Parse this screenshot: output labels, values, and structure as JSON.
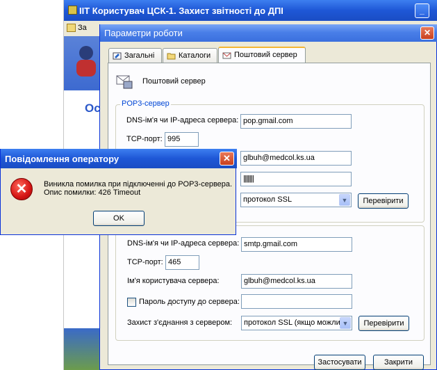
{
  "background_window": {
    "title": "IIT Користувач ЦСК-1. Захист звітності до ДПІ",
    "menu_item": "За",
    "side_letter": "Ос"
  },
  "dialog": {
    "title": "Параметри роботи",
    "tabs": [
      {
        "label": "Загальні"
      },
      {
        "label": "Каталоги"
      },
      {
        "label": "Поштовий сервер"
      }
    ],
    "section_title": "Поштовий сервер",
    "pop3": {
      "legend": "POP3-сервер",
      "dns_label": "DNS-ім'я чи IP-адреса сервера:",
      "dns_value": "pop.gmail.com",
      "port_label": "TCP-порт:",
      "port_value": "995",
      "user_value": "glbuh@medcol.ks.ua",
      "password_value": "||||||||",
      "protocol_value": "протокол SSL",
      "check_button": "Перевірити"
    },
    "smtp": {
      "dns_label": "DNS-ім'я чи IP-адреса сервера:",
      "dns_value": "smtp.gmail.com",
      "port_label": "TCP-порт:",
      "port_value": "465",
      "user_label": "Ім'я користувача сервера:",
      "user_value": "glbuh@medcol.ks.ua",
      "password_checkbox_label": "Пароль доступу до сервера:",
      "password_checked": false,
      "password_value": "",
      "protection_label": "Захист з'єднання з сервером:",
      "protocol_value": "протокол SSL (якщо можли",
      "check_button": "Перевірити"
    },
    "apply_button": "Застосувати",
    "close_button": "Закрити"
  },
  "message_box": {
    "title": "Повідомлення оператору",
    "line1": "Виникла помилка при підключенні до POP3-сервера.",
    "line2": "Опис помилки: 426 Timeout",
    "ok_button": "OK"
  },
  "colors": {
    "title_blue": "#1e57d6",
    "dialog_face": "#ece9d8",
    "legend_blue": "#0046d5",
    "error_red": "#d41414"
  }
}
